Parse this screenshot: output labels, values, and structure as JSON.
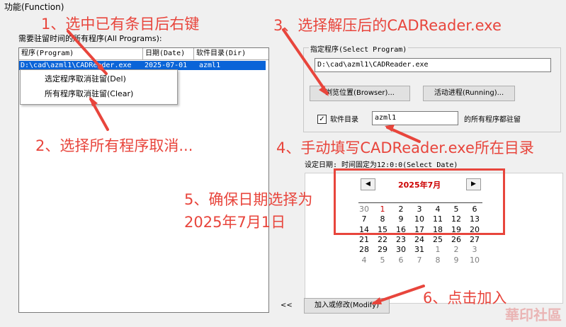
{
  "window": {
    "title": "功能(Function)"
  },
  "programs": {
    "label": "需要驻留时间的所有程序(All Programs):",
    "columns": [
      "程序(Program)",
      "日期(Date)",
      "软件目录(Dir)"
    ],
    "rows": [
      {
        "program": "D:\\cad\\azml1\\CADReader.exe",
        "date": "2025-07-01",
        "dir": "azml1"
      }
    ]
  },
  "context_menu": {
    "items": [
      "选定程序取消驻留(Del)",
      "所有程序取消驻留(Clear)"
    ]
  },
  "select_program": {
    "legend": "指定程序(Select Program)",
    "path": "D:\\cad\\azml1\\CADReader.exe",
    "browse_label": "浏览位置(Browser)...",
    "running_label": "活动进程(Running)...",
    "checkbox_label": "软件目录",
    "checkbox_checked": true,
    "dir_value": "azml1",
    "dir_suffix": "的所有程序都驻留"
  },
  "date": {
    "label": "设定日期: 时间固定为12:0:0(Select Date)",
    "month_title": "2025年7月",
    "prev": "◀",
    "next": "▶",
    "weeks": [
      [
        "30",
        "1",
        "2",
        "3",
        "4",
        "5",
        "6"
      ],
      [
        "7",
        "8",
        "9",
        "10",
        "11",
        "12",
        "13"
      ],
      [
        "14",
        "15",
        "16",
        "17",
        "18",
        "19",
        "20"
      ],
      [
        "21",
        "22",
        "23",
        "24",
        "25",
        "26",
        "27"
      ],
      [
        "28",
        "29",
        "30",
        "31",
        "1",
        "2",
        "3"
      ],
      [
        "4",
        "5",
        "6",
        "7",
        "8",
        "9",
        "10"
      ]
    ],
    "selected_day": "1",
    "colors": {
      "header": "#cc0000",
      "other_month": "#808080",
      "selected": "#cc0000"
    }
  },
  "footer": {
    "collapse_label": "<<",
    "modify_label": "加入或修改(Modify)"
  },
  "annotations": {
    "a1": "1、选中已有条目后右键",
    "a2": "2、选择所有程序取消...",
    "a3": "3、选择解压后的CADReader.exe",
    "a4": "4、手动填写CADReader.exe所在目录",
    "a5_line1": "5、确保日期选择为",
    "a5_line2": "2025年7月1日",
    "a6": "6、点击加入"
  },
  "watermark": "華印社區",
  "colors": {
    "annotation": "#e8453c",
    "selection": "#0a64d8"
  }
}
